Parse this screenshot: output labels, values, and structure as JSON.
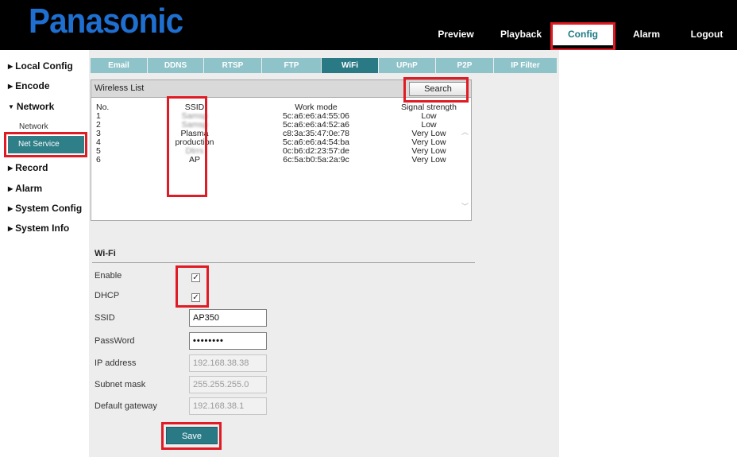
{
  "header": {
    "logo": "Panasonic",
    "nav": [
      {
        "label": "Preview"
      },
      {
        "label": "Playback"
      },
      {
        "label": "Config"
      },
      {
        "label": "Alarm"
      },
      {
        "label": "Logout"
      }
    ],
    "active": "Config"
  },
  "sidebar": {
    "items": [
      {
        "label": "Local Config",
        "arrow": "▶"
      },
      {
        "label": "Encode",
        "arrow": "▶"
      },
      {
        "label": "Network",
        "arrow": "▼"
      },
      {
        "label": "Record",
        "arrow": "▶"
      },
      {
        "label": "Alarm",
        "arrow": "▶"
      },
      {
        "label": "System Config",
        "arrow": "▶"
      },
      {
        "label": "System Info",
        "arrow": "▶"
      }
    ],
    "sub": [
      {
        "label": "Network"
      },
      {
        "label": "Net Service"
      }
    ]
  },
  "tabs": [
    {
      "label": "Email"
    },
    {
      "label": "DDNS"
    },
    {
      "label": "RTSP"
    },
    {
      "label": "FTP"
    },
    {
      "label": "WiFi"
    },
    {
      "label": "UPnP"
    },
    {
      "label": "P2P"
    },
    {
      "label": "IP Filter"
    }
  ],
  "wireless_list": {
    "title": "Wireless List",
    "search_label": "Search",
    "columns": {
      "no": "No.",
      "ssid": "SSID",
      "mode": "Work mode",
      "signal": "Signal strength"
    },
    "rows": [
      {
        "no": "1",
        "ssid": "Samsp",
        "mode": "5c:a6:e6:a4:55:06",
        "signal": "Low"
      },
      {
        "no": "2",
        "ssid": "Samsp",
        "mode": "5c:a6:e6:a4:52:a6",
        "signal": "Low"
      },
      {
        "no": "3",
        "ssid": "Plasma",
        "mode": "c8:3a:35:47:0e:78",
        "signal": "Very Low"
      },
      {
        "no": "4",
        "ssid": "production",
        "mode": "5c:a6:e6:a4:54:ba",
        "signal": "Very Low"
      },
      {
        "no": "5",
        "ssid": "Dtrrs",
        "mode": "0c:b6:d2:23:57:de",
        "signal": "Very Low"
      },
      {
        "no": "6",
        "ssid": "AP",
        "mode": "6c:5a:b0:5a:2a:9c",
        "signal": "Very Low"
      }
    ]
  },
  "wifi": {
    "title": "Wi-Fi",
    "enable_label": "Enable",
    "enable_checked": true,
    "dhcp_label": "DHCP",
    "dhcp_checked": true,
    "ssid_label": "SSID",
    "ssid_value": "AP350",
    "password_label": "PassWord",
    "password_value": "••••••••",
    "ip_label": "IP address",
    "ip_value": "192.168.38.38",
    "mask_label": "Subnet mask",
    "mask_value": "255.255.255.0",
    "gateway_label": "Default gateway",
    "gateway_value": "192.168.38.1",
    "save_label": "Save",
    "check_glyph": "✓"
  },
  "colors": {
    "accent": "#2a7a86",
    "tab_inactive": "#8ec3c9",
    "logo": "#1f6fd1",
    "highlight_box": "#e01b24"
  }
}
